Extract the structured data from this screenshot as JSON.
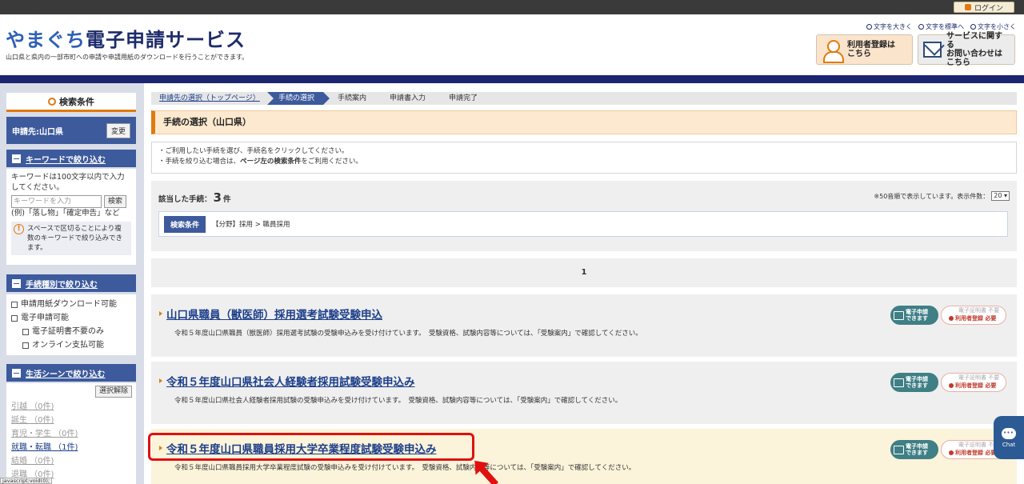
{
  "topbar": {
    "login_label": "ログイン"
  },
  "header": {
    "logo_prefix": "やまぐち",
    "logo_main": "電子申請サービス",
    "tagline": "山口県と県内の一部市町への申請や申請用紙のダウンロードを行うことができます。",
    "font_sizes": [
      "文字を大きく",
      "文字を標準へ",
      "文字を小さく"
    ],
    "register_button": {
      "line1": "利用者登録は",
      "line2": "こちら"
    },
    "inquiry_button": {
      "line1": "サービスに関する",
      "line2": "お問い合わせはこちら"
    }
  },
  "sidebar": {
    "search_title": "検索条件",
    "destination": "申請先:山口県",
    "change_label": "変更",
    "keyword_section": "キーワードで絞り込む",
    "keyword_help": "キーワードは100文字以内で入力してください。",
    "keyword_placeholder": "キーワードを入力",
    "keyword_search": "検索",
    "keyword_example": "(例)「落し物」「確定申告」など",
    "keyword_note": "スペースで区切ることにより複数のキーワードで絞り込みできます。",
    "type_section": "手続種別で絞り込む",
    "type_options": [
      "申請用紙ダウンロード可能",
      "電子申請可能",
      "電子証明書不要のみ",
      "オンライン支払可能"
    ],
    "life_section": "生活シーンで絞り込む",
    "clear_label": "選択解除",
    "life_items": [
      "引越 （0件)",
      "誕生 （0件)",
      "育児・学生 （0件)",
      "就職・転職 （1件)",
      "結婚 （0件)",
      "退職 （0件)"
    ]
  },
  "steps": [
    "申請先の選択（トップページ）",
    "手続の選択",
    "手続案内",
    "申請書入力",
    "申請完了"
  ],
  "main": {
    "section_title": "手続の選択（山口県）",
    "instruction1": "・ご利用したい手続を選び、手続名をクリックしてください。",
    "instruction2_pre": "・手続を絞り込む場合は、",
    "instruction2_bold": "ページ左の検索条件",
    "instruction2_post": "をご利用ください。",
    "count_label": "該当した手続：",
    "count_value": "3",
    "count_unit": "件",
    "sort_note": "※50音順で表示しています。表示件数：",
    "page_size": "20",
    "cond_label": "検索条件",
    "cond_value": "【分野】採用 > 職員採用",
    "page_number": "1"
  },
  "procedures": [
    {
      "title": "山口県職員（獣医師）採用選考試験受験申込",
      "desc": "令和５年度山口県職員（獣医師）採用選考試験の受験申込みを受け付けています。　受験資格、試験内容等については、「受験案内」で確認してください。"
    },
    {
      "title": "令和５年度山口県社会人経験者採用試験受験申込み",
      "desc": "令和５年度山口県社会人経験者採用試験の受験申込みを受け付けています。　受験資格、試験内容等については、「受験案内」で確認してください。"
    },
    {
      "title": "令和５年度山口県職員採用大学卒業程度試験受験申込み",
      "desc": "令和５年度山口県職員採用大学卒業程度試験の受験申込みを受け付けています。　受験資格、試験内容等については、「受験案内」で確認してください。"
    }
  ],
  "badges": {
    "e_apply_line1": "電子申請",
    "e_apply_line2": "できます",
    "cert_line1": "電子証明書 不要",
    "cert_line2": "利用者登録 必要"
  },
  "chat_label": "Chat",
  "status_text": "javascript:void(0);",
  "colors": {
    "navy": "#1c2570",
    "accent": "#e07a10",
    "link": "#1c3e8a",
    "highlight": "#e01010"
  }
}
